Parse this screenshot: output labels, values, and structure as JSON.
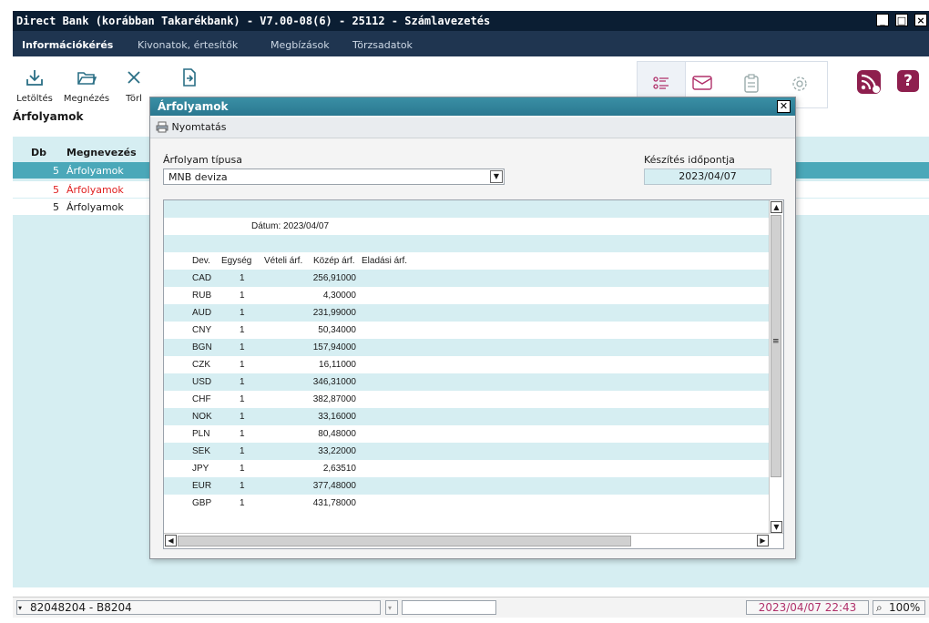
{
  "window": {
    "title": "Direct Bank (korábban Takarékbank) - V7.00-08(6) - 25112 - Számlavezetés",
    "btn_min": "_",
    "btn_max": "□",
    "btn_close": "×"
  },
  "menu": {
    "items": [
      "Információkérés",
      "Kivonatok, értesítők",
      "Megbízások",
      "Törzsadatok"
    ]
  },
  "toolbar": {
    "download": "Letöltés",
    "view": "Megnézés",
    "delete": "Törl"
  },
  "section": {
    "title": "Árfolyamok"
  },
  "list": {
    "col_db": "Db",
    "col_name": "Megnevezés",
    "rows": [
      {
        "db": "5",
        "name": "Árfolyamok"
      },
      {
        "db": "5",
        "name": "Árfolyamok"
      },
      {
        "db": "5",
        "name": "Árfolyamok"
      }
    ]
  },
  "dialog": {
    "title": "Árfolyamok",
    "print": "Nyomtatás",
    "type_label": "Árfolyam típusa",
    "type_value": "MNB deviza",
    "created_label": "Készítés időpontja",
    "created_value": "2023/04/07",
    "report": {
      "date_line": "Dátum: 2023/04/07",
      "headers": {
        "dev": "Dev.",
        "unit": "Egység",
        "buy": "Vételi árf.",
        "mid": "Közép árf.",
        "sell": "Eladási árf."
      },
      "rates": [
        {
          "dev": "CAD",
          "unit": "1",
          "mid": "256,91000"
        },
        {
          "dev": "RUB",
          "unit": "1",
          "mid": "4,30000"
        },
        {
          "dev": "AUD",
          "unit": "1",
          "mid": "231,99000"
        },
        {
          "dev": "CNY",
          "unit": "1",
          "mid": "50,34000"
        },
        {
          "dev": "BGN",
          "unit": "1",
          "mid": "157,94000"
        },
        {
          "dev": "CZK",
          "unit": "1",
          "mid": "16,11000"
        },
        {
          "dev": "USD",
          "unit": "1",
          "mid": "346,31000"
        },
        {
          "dev": "CHF",
          "unit": "1",
          "mid": "382,87000"
        },
        {
          "dev": "NOK",
          "unit": "1",
          "mid": "33,16000"
        },
        {
          "dev": "PLN",
          "unit": "1",
          "mid": "80,48000"
        },
        {
          "dev": "SEK",
          "unit": "1",
          "mid": "33,22000"
        },
        {
          "dev": "JPY",
          "unit": "1",
          "mid": "2,63510"
        },
        {
          "dev": "EUR",
          "unit": "1",
          "mid": "377,48000"
        },
        {
          "dev": "GBP",
          "unit": "1",
          "mid": "431,78000"
        }
      ]
    }
  },
  "status": {
    "account": "82048204 - B8204",
    "datetime": "2023/04/07 22:43",
    "zoom": "100%"
  },
  "colors": {
    "titlebar": "#0b1e33",
    "menubar": "#1f3550",
    "accent": "#4aa8b9",
    "panel": "#d6eef2",
    "warning_text": "#e02020",
    "status_datetime": "#b0306a"
  }
}
